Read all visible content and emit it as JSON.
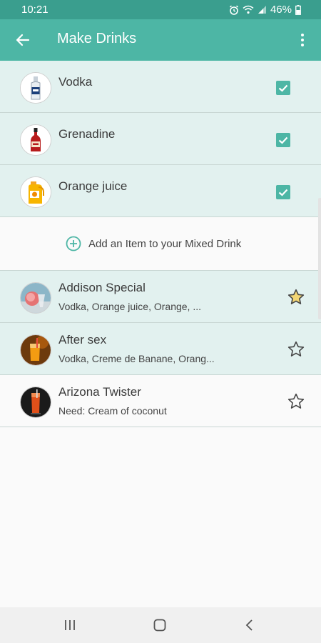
{
  "status_bar": {
    "time": "10:21",
    "battery": "46%",
    "icons": [
      "alarm-icon",
      "wifi-icon",
      "signal-icon",
      "battery-icon"
    ]
  },
  "app_bar": {
    "title": "Make Drinks",
    "back_icon": "arrow-left-icon",
    "menu_icon": "more-vert-icon"
  },
  "ingredients": [
    {
      "name": "Vodka",
      "checked": true,
      "icon": "vodka-bottle-icon"
    },
    {
      "name": "Grenadine",
      "checked": true,
      "icon": "grenadine-bottle-icon"
    },
    {
      "name": "Orange juice",
      "checked": true,
      "icon": "orange-juice-icon"
    }
  ],
  "add_item": {
    "label": "Add an Item to your Mixed Drink",
    "icon": "add-circle-icon"
  },
  "drinks": [
    {
      "name": "Addison Special",
      "subtitle": "Vodka, Orange juice, Orange, ...",
      "starred": true
    },
    {
      "name": "After sex",
      "subtitle": "Vodka, Creme de Banane, Orang...",
      "starred": false
    },
    {
      "name": "Arizona Twister",
      "subtitle": "Need: Cream of coconut",
      "starred": false
    }
  ],
  "colors": {
    "status_bar": "#3a9e8e",
    "app_bar": "#4db6a5",
    "accent": "#4db6a5",
    "selected_row": "#e2f1ef",
    "star_fill": "#f2d675"
  },
  "nav_bar": [
    "recents-icon",
    "home-icon",
    "back-icon"
  ]
}
